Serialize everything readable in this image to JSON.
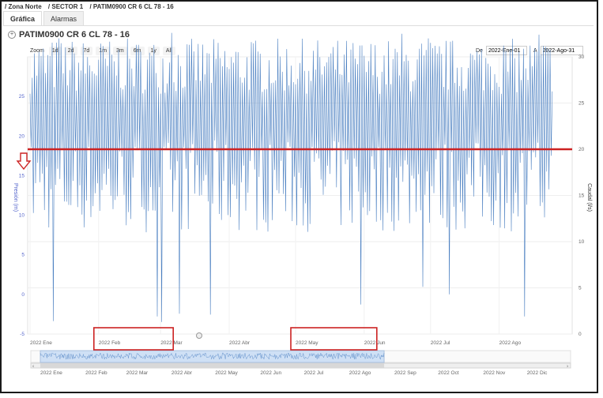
{
  "breadcrumb": [
    "/ Zona Norte",
    "/ SECTOR 1",
    "/ PATIM0900 CR 6 CL 78 - 16"
  ],
  "tabs": [
    {
      "label": "Gráfica",
      "active": true
    },
    {
      "label": "Alarmas",
      "active": false
    }
  ],
  "title": "PATIM0900 CR 6 CL 78 - 16",
  "zoom": {
    "label": "Zoom",
    "buttons": [
      "1d",
      "2d",
      "7d",
      "1m",
      "3m",
      "6m",
      "1y",
      "All"
    ]
  },
  "range": {
    "from_label": "De",
    "from_value": "2022-Ene-01",
    "to_label": "A",
    "to_value": "2022-Ago-31"
  },
  "colors": {
    "series": "#4a7fc1",
    "threshold": "#cc2222",
    "annotation": "#cc2222",
    "navigator_fill": "#cfe0f5"
  },
  "chart_data": {
    "type": "line",
    "left_axis": {
      "label": "Presión (m)",
      "ticks": [
        "25",
        "20",
        "15",
        "10",
        "5",
        "0",
        "-5"
      ],
      "range": [
        -5,
        30
      ]
    },
    "right_axis": {
      "label": "Caudal (l/s)",
      "ticks": [
        "30",
        "25",
        "20",
        "15",
        "10",
        "5",
        "0"
      ],
      "range": [
        0,
        30
      ]
    },
    "x_ticks": [
      "2022 Ene",
      "2022 Feb",
      "2022 Mar",
      "2022 Abr",
      "2022 May",
      "2022 Jun",
      "2022 Jul",
      "2022 Ago"
    ],
    "threshold_right_axis": 20,
    "series_range": {
      "start": "2022-01-01",
      "end": "2022-08-24"
    },
    "series_right_axis_values": {
      "typical_high": 30,
      "typical_low": 14,
      "min_spikes": [
        1.4,
        1.9,
        1.3,
        2.2,
        2.1,
        3.2,
        5.1,
        4.3,
        1.9
      ],
      "max_spikes": [
        32,
        32.6,
        31.6,
        32.5,
        32,
        32.4,
        31.4
      ]
    },
    "navigator_ticks": [
      "2022 Ene",
      "2022 Feb",
      "2022 Mar",
      "2022 Abr",
      "2022 May",
      "2022 Jun",
      "2022 Jul",
      "2022 Ago",
      "2022 Sep",
      "2022 Oct",
      "2022 Nov",
      "2022 Dic"
    ],
    "annotated_ranges": [
      {
        "from": "2022 Feb",
        "to": "2022 Mar"
      },
      {
        "from": "2022 May",
        "to": "2022 Jun"
      }
    ]
  }
}
